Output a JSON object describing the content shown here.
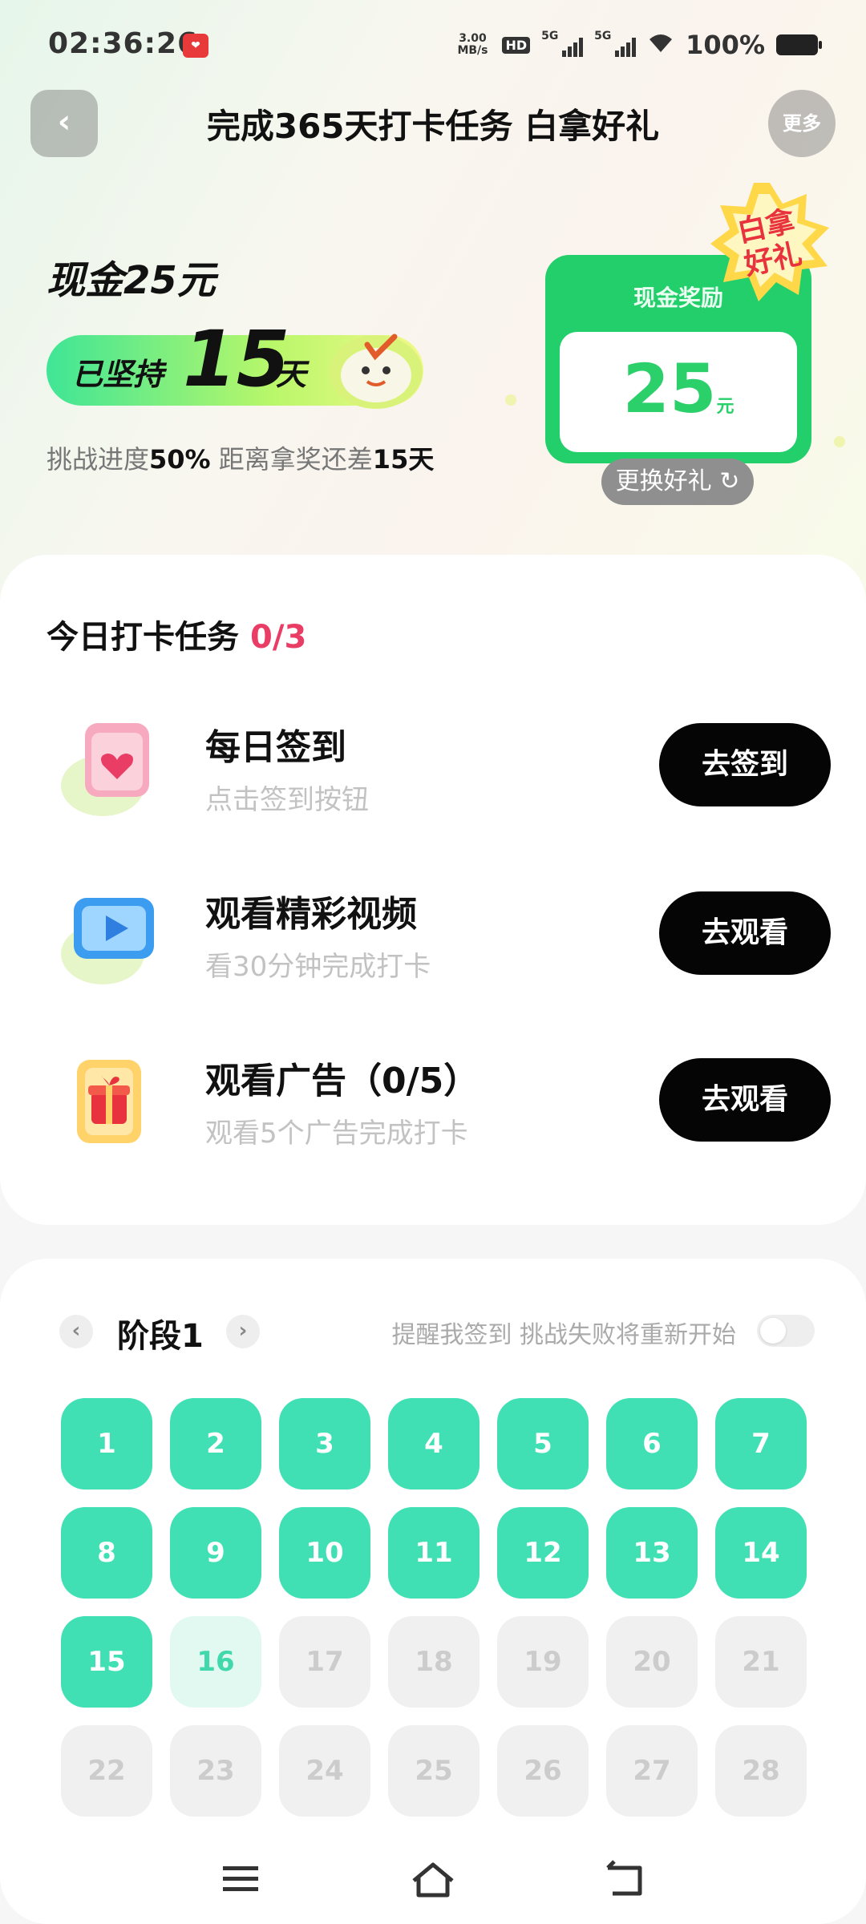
{
  "status_bar": {
    "time": "02:36:26",
    "app_icon": "app-notification-icon",
    "net_speed_value": "3.00",
    "net_speed_unit": "MB/s",
    "hd": "HD",
    "sim1": "5G",
    "sim2": "5G",
    "battery": "100%"
  },
  "header": {
    "back_icon": "‹",
    "title": "完成365天打卡任务 白拿好礼",
    "more_label": "更多"
  },
  "hero": {
    "cash_title": "现金25元",
    "persist_prefix": "已坚持",
    "persist_days": "15",
    "persist_suffix": "天",
    "progress_prefix": "挑战进度",
    "progress_value": "50%",
    "progress_middle": " 距离拿奖还差",
    "progress_remaining": "15天",
    "progress_fraction": 0.5
  },
  "reward": {
    "label": "现金奖励",
    "amount": "25",
    "unit": "元",
    "badge_line1": "白拿",
    "badge_line2": "好礼",
    "swap_label": "更换好礼 ↻"
  },
  "tasks": {
    "title": "今日打卡任务",
    "count": "0/3",
    "items": [
      {
        "name": "每日签到",
        "desc": "点击签到按钮",
        "button": "去签到",
        "icon": "calendar-heart-icon"
      },
      {
        "name": "观看精彩视频",
        "desc": "看30分钟完成打卡",
        "button": "去观看",
        "icon": "video-play-icon"
      },
      {
        "name": "观看广告（0/5）",
        "desc": "观看5个广告完成打卡",
        "button": "去观看",
        "icon": "gift-box-icon"
      }
    ]
  },
  "calendar": {
    "prev_icon": "‹",
    "next_icon": "›",
    "stage_label": "阶段1",
    "reminder_text": "提醒我签到 挑战失败将重新开始",
    "reminder_on": false,
    "days_completed": 15,
    "today": 16,
    "days": [
      "1",
      "2",
      "3",
      "4",
      "5",
      "6",
      "7",
      "8",
      "9",
      "10",
      "11",
      "12",
      "13",
      "14",
      "15",
      "16",
      "17",
      "18",
      "19",
      "20",
      "21",
      "22",
      "23",
      "24",
      "25",
      "26",
      "27",
      "28"
    ]
  },
  "colors": {
    "accent_green": "#41e0b4",
    "reward_green": "#22cf6a",
    "count_red": "#ea3d66",
    "button_black": "#050505"
  }
}
